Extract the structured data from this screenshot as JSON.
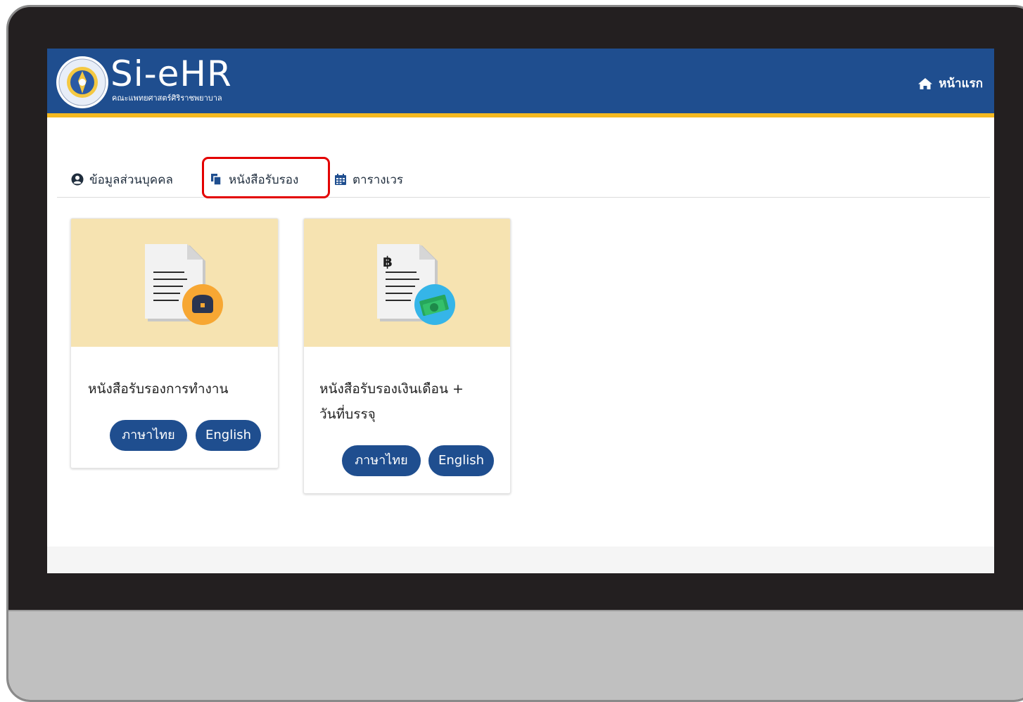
{
  "header": {
    "brand": "Si-eHR",
    "brand_subtitle": "คณะแพทยศาสตร์ศิริราชพยาบาล",
    "home_label": "หน้าแรก"
  },
  "tabs": [
    {
      "label": "ข้อมูลส่วนบุคคล",
      "icon": "user-circle-icon"
    },
    {
      "label": "หนังสือรับรอง",
      "icon": "copy-icon"
    },
    {
      "label": "ตารางเวร",
      "icon": "calendar-icon"
    }
  ],
  "cards": [
    {
      "title": "หนังสือรับรองการทำงาน",
      "icon": "document-briefcase-icon",
      "buttons": [
        "ภาษาไทย",
        "English"
      ]
    },
    {
      "title_line1": "หนังสือรับรองเงินเดือน +",
      "title_line2": "วันที่บรรจุ",
      "icon": "document-money-icon",
      "doc_mark": "฿",
      "buttons": [
        "ภาษาไทย",
        "English"
      ]
    }
  ],
  "colors": {
    "primary": "#1f4e8f",
    "accent": "#f5b920",
    "card_image_bg": "#f6e3b1",
    "highlight": "#e30000"
  }
}
